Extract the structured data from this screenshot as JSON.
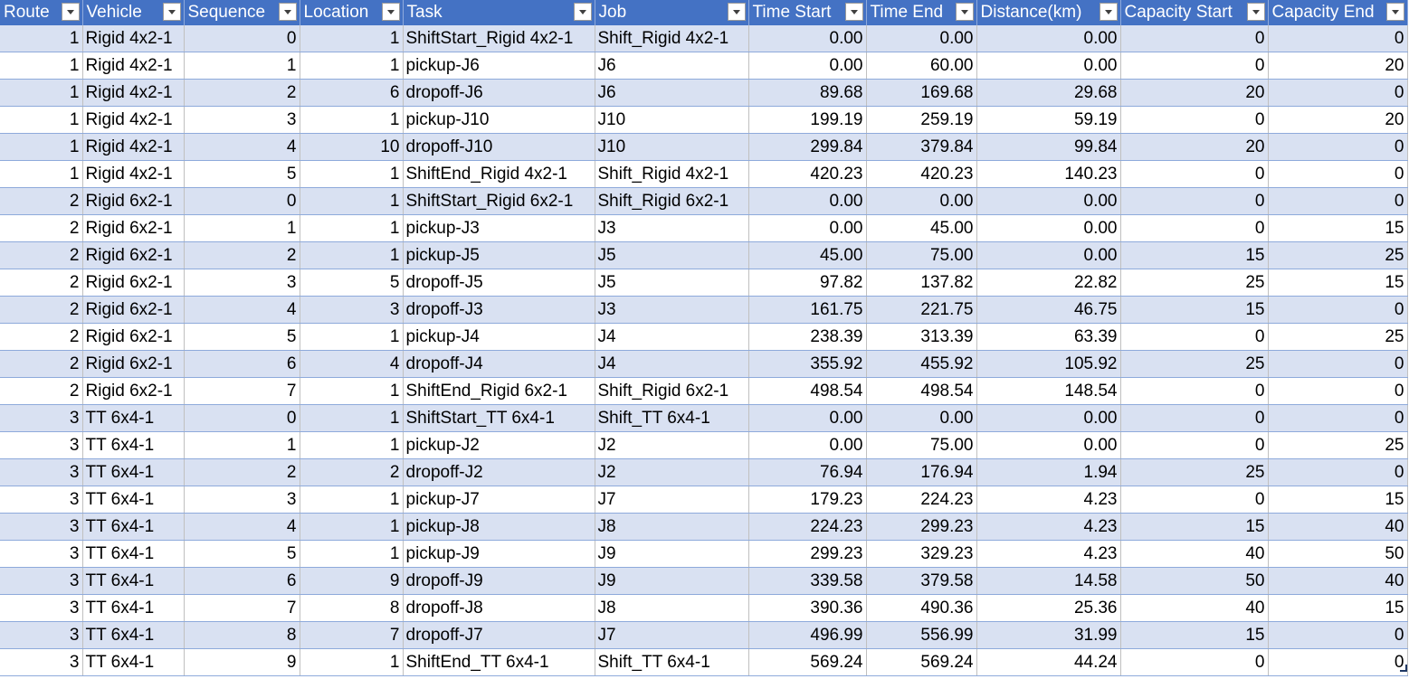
{
  "headers": [
    "Route",
    "Vehicle",
    "Sequence",
    "Location",
    "Task",
    "Job",
    "Time Start",
    "Time End",
    "Distance(km)",
    "Capacity Start",
    "Capacity End"
  ],
  "rows": [
    [
      "1",
      "Rigid 4x2-1",
      "0",
      "1",
      "ShiftStart_Rigid 4x2-1",
      "Shift_Rigid 4x2-1",
      "0.00",
      "0.00",
      "0.00",
      "0",
      "0"
    ],
    [
      "1",
      "Rigid 4x2-1",
      "1",
      "1",
      "pickup-J6",
      "J6",
      "0.00",
      "60.00",
      "0.00",
      "0",
      "20"
    ],
    [
      "1",
      "Rigid 4x2-1",
      "2",
      "6",
      "dropoff-J6",
      "J6",
      "89.68",
      "169.68",
      "29.68",
      "20",
      "0"
    ],
    [
      "1",
      "Rigid 4x2-1",
      "3",
      "1",
      "pickup-J10",
      "J10",
      "199.19",
      "259.19",
      "59.19",
      "0",
      "20"
    ],
    [
      "1",
      "Rigid 4x2-1",
      "4",
      "10",
      "dropoff-J10",
      "J10",
      "299.84",
      "379.84",
      "99.84",
      "20",
      "0"
    ],
    [
      "1",
      "Rigid 4x2-1",
      "5",
      "1",
      "ShiftEnd_Rigid 4x2-1",
      "Shift_Rigid 4x2-1",
      "420.23",
      "420.23",
      "140.23",
      "0",
      "0"
    ],
    [
      "2",
      "Rigid 6x2-1",
      "0",
      "1",
      "ShiftStart_Rigid 6x2-1",
      "Shift_Rigid 6x2-1",
      "0.00",
      "0.00",
      "0.00",
      "0",
      "0"
    ],
    [
      "2",
      "Rigid 6x2-1",
      "1",
      "1",
      "pickup-J3",
      "J3",
      "0.00",
      "45.00",
      "0.00",
      "0",
      "15"
    ],
    [
      "2",
      "Rigid 6x2-1",
      "2",
      "1",
      "pickup-J5",
      "J5",
      "45.00",
      "75.00",
      "0.00",
      "15",
      "25"
    ],
    [
      "2",
      "Rigid 6x2-1",
      "3",
      "5",
      "dropoff-J5",
      "J5",
      "97.82",
      "137.82",
      "22.82",
      "25",
      "15"
    ],
    [
      "2",
      "Rigid 6x2-1",
      "4",
      "3",
      "dropoff-J3",
      "J3",
      "161.75",
      "221.75",
      "46.75",
      "15",
      "0"
    ],
    [
      "2",
      "Rigid 6x2-1",
      "5",
      "1",
      "pickup-J4",
      "J4",
      "238.39",
      "313.39",
      "63.39",
      "0",
      "25"
    ],
    [
      "2",
      "Rigid 6x2-1",
      "6",
      "4",
      "dropoff-J4",
      "J4",
      "355.92",
      "455.92",
      "105.92",
      "25",
      "0"
    ],
    [
      "2",
      "Rigid 6x2-1",
      "7",
      "1",
      "ShiftEnd_Rigid 6x2-1",
      "Shift_Rigid 6x2-1",
      "498.54",
      "498.54",
      "148.54",
      "0",
      "0"
    ],
    [
      "3",
      "TT 6x4-1",
      "0",
      "1",
      "ShiftStart_TT 6x4-1",
      "Shift_TT 6x4-1",
      "0.00",
      "0.00",
      "0.00",
      "0",
      "0"
    ],
    [
      "3",
      "TT 6x4-1",
      "1",
      "1",
      "pickup-J2",
      "J2",
      "0.00",
      "75.00",
      "0.00",
      "0",
      "25"
    ],
    [
      "3",
      "TT 6x4-1",
      "2",
      "2",
      "dropoff-J2",
      "J2",
      "76.94",
      "176.94",
      "1.94",
      "25",
      "0"
    ],
    [
      "3",
      "TT 6x4-1",
      "3",
      "1",
      "pickup-J7",
      "J7",
      "179.23",
      "224.23",
      "4.23",
      "0",
      "15"
    ],
    [
      "3",
      "TT 6x4-1",
      "4",
      "1",
      "pickup-J8",
      "J8",
      "224.23",
      "299.23",
      "4.23",
      "15",
      "40"
    ],
    [
      "3",
      "TT 6x4-1",
      "5",
      "1",
      "pickup-J9",
      "J9",
      "299.23",
      "329.23",
      "4.23",
      "40",
      "50"
    ],
    [
      "3",
      "TT 6x4-1",
      "6",
      "9",
      "dropoff-J9",
      "J9",
      "339.58",
      "379.58",
      "14.58",
      "50",
      "40"
    ],
    [
      "3",
      "TT 6x4-1",
      "7",
      "8",
      "dropoff-J8",
      "J8",
      "390.36",
      "490.36",
      "25.36",
      "40",
      "15"
    ],
    [
      "3",
      "TT 6x4-1",
      "8",
      "7",
      "dropoff-J7",
      "J7",
      "496.99",
      "556.99",
      "31.99",
      "15",
      "0"
    ],
    [
      "3",
      "TT 6x4-1",
      "9",
      "1",
      "ShiftEnd_TT 6x4-1",
      "Shift_TT 6x4-1",
      "569.24",
      "569.24",
      "44.24",
      "0",
      "0"
    ]
  ],
  "colors": {
    "header_bg": "#4472c4",
    "band_bg": "#d9e1f2",
    "row_bg": "#ffffff"
  },
  "icons": {
    "filter_button": "chevron-down-icon",
    "resize_handle": "table-resize-icon"
  }
}
